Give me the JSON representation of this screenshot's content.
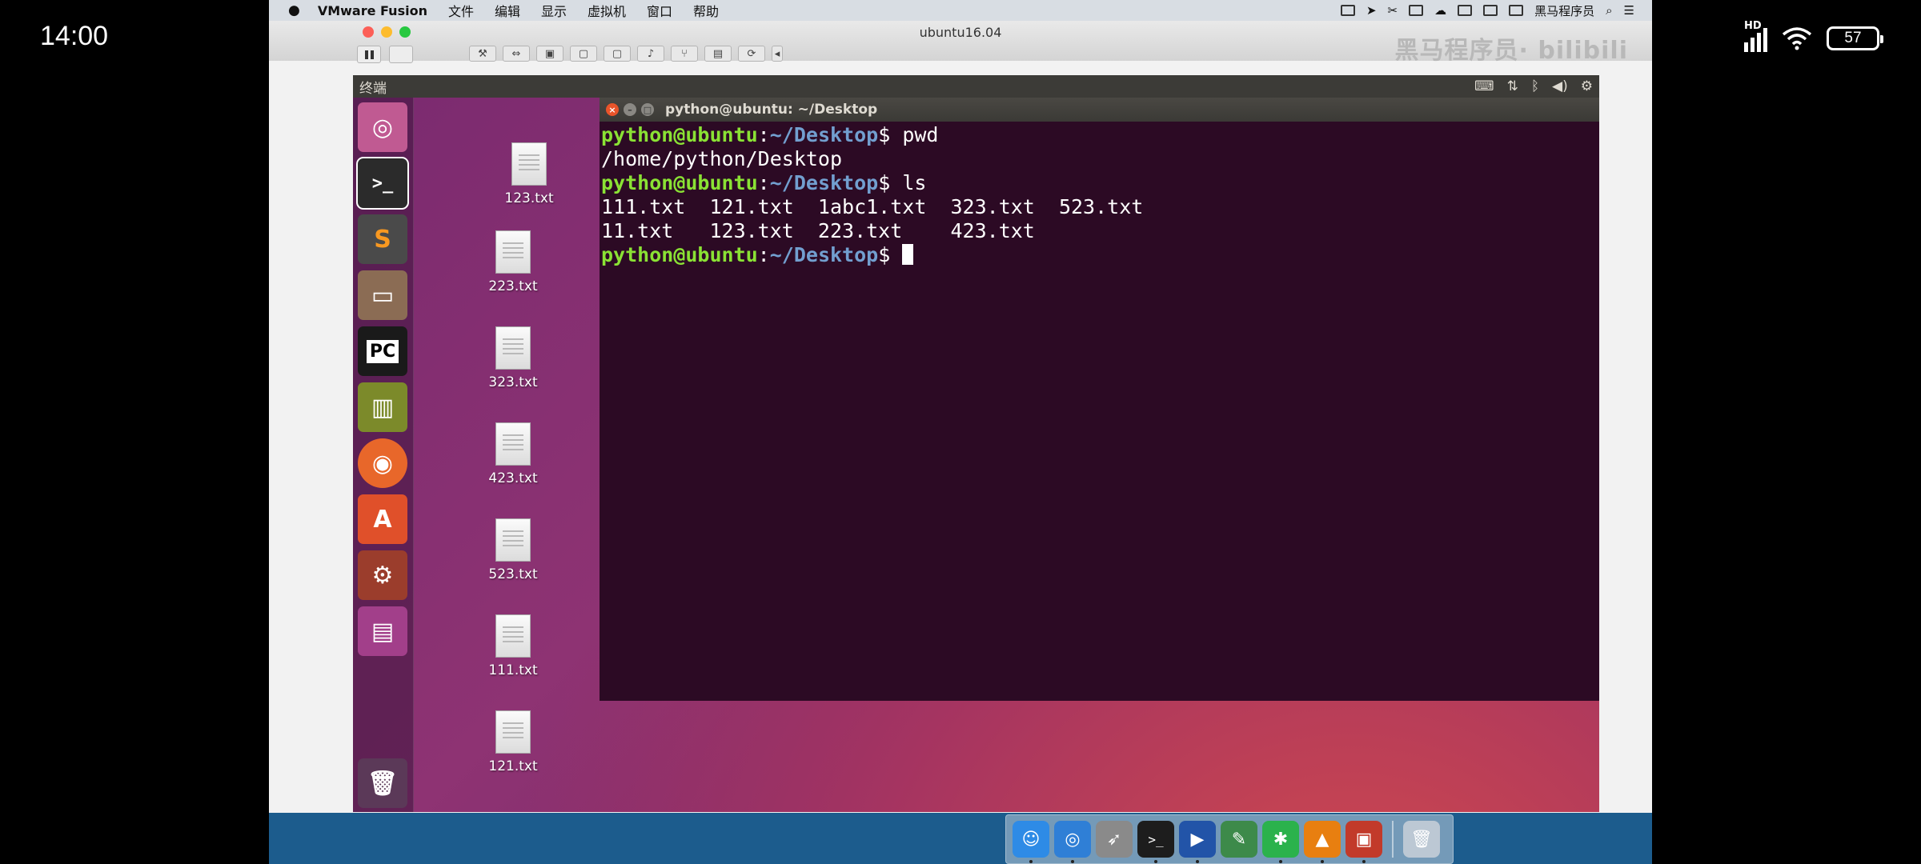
{
  "phone": {
    "time": "14:00",
    "network_label": "HD",
    "battery": "57"
  },
  "mac_menubar": {
    "app_name": "VMware Fusion",
    "menus": [
      "文件",
      "编辑",
      "显示",
      "虚拟机",
      "窗口",
      "帮助"
    ],
    "right_user": "黑马程序员"
  },
  "vmware": {
    "window_title": "ubuntu16.04",
    "watermark": "黑马程序员·",
    "watermark_logo": "bilibili"
  },
  "ubuntu": {
    "topbar_title": "终端",
    "launcher": [
      {
        "name": "ubuntu-dash",
        "glyph": "◎",
        "bg": "#c05a92"
      },
      {
        "name": "terminal",
        "glyph": ">_",
        "bg": "#2b2b2b"
      },
      {
        "name": "sublime-text",
        "glyph": "S",
        "bg": "#4a4a4a"
      },
      {
        "name": "files",
        "glyph": "▭",
        "bg": "#8b6c54"
      },
      {
        "name": "pycharm",
        "glyph": "PC",
        "bg": "#1a1a1a"
      },
      {
        "name": "books",
        "glyph": "▥",
        "bg": "#7c8a2a"
      },
      {
        "name": "firefox",
        "glyph": "◉",
        "bg": "#e8672a"
      },
      {
        "name": "software-center",
        "glyph": "A",
        "bg": "#e0502a"
      },
      {
        "name": "system-settings",
        "glyph": "⚙",
        "bg": "#9b3d2c"
      },
      {
        "name": "workspaces",
        "glyph": "▤",
        "bg": "#a23f8a"
      },
      {
        "name": "trash",
        "glyph": "🗑",
        "bg": "#5b3958"
      }
    ],
    "desktop_files": [
      "123.txt",
      "223.txt",
      "323.txt",
      "423.txt",
      "523.txt",
      "111.txt",
      "121.txt"
    ]
  },
  "terminal": {
    "title": "python@ubuntu: ~/Desktop",
    "prompt_user": "python@ubuntu",
    "prompt_sep": ":",
    "prompt_path": "~/Desktop",
    "prompt_dollar": "$",
    "cmd1": " pwd",
    "out1": "/home/python/Desktop",
    "cmd2": " ls",
    "ls_row1": "111.txt  121.txt  1abc1.txt  323.txt  523.txt",
    "ls_row2": "11.txt   123.txt  223.txt    423.txt"
  },
  "dock": [
    {
      "name": "finder",
      "glyph": "☺",
      "bg": "#2e8be6"
    },
    {
      "name": "safari",
      "glyph": "◎",
      "bg": "#2f7fd6"
    },
    {
      "name": "launchpad",
      "glyph": "➶",
      "bg": "#8a8a8a"
    },
    {
      "name": "terminal",
      "glyph": ">_",
      "bg": "#1d1d1d"
    },
    {
      "name": "screenflow",
      "glyph": "▶",
      "bg": "#2254a8"
    },
    {
      "name": "stickies",
      "glyph": "✎",
      "bg": "#3d8a4a"
    },
    {
      "name": "xmind",
      "glyph": "✱",
      "bg": "#2bb24c"
    },
    {
      "name": "vlc",
      "glyph": "▲",
      "bg": "#e87f10"
    },
    {
      "name": "vmware-fusion",
      "glyph": "▣",
      "bg": "#c23a2a"
    }
  ],
  "dock_trash": {
    "name": "trash",
    "glyph": "🗑",
    "bg": "#bcc8d4"
  }
}
